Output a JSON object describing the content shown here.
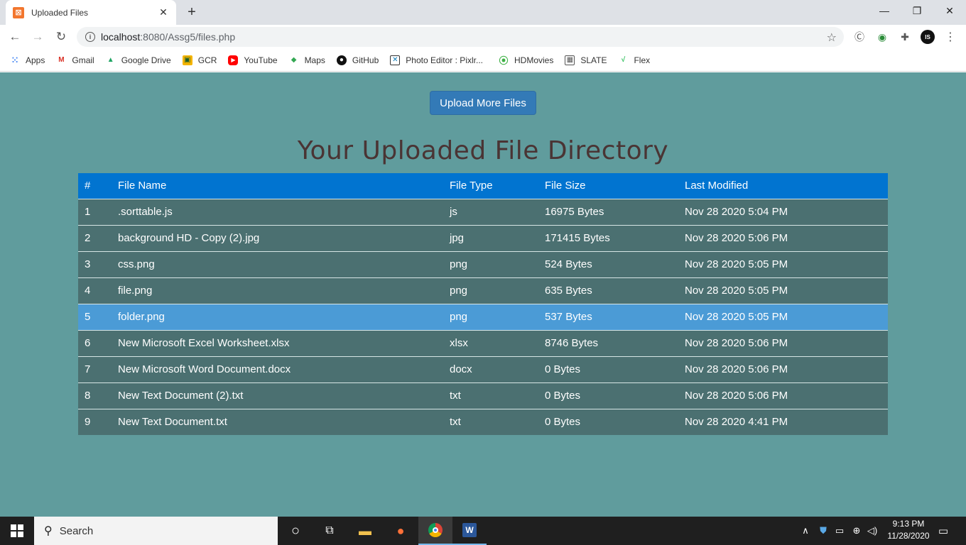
{
  "browser": {
    "tab_title": "Uploaded Files",
    "tab_icon": "xampp-icon",
    "url_host": "localhost",
    "url_rest": ":8080/Assg5/files.php",
    "bookmarks": [
      {
        "label": "Apps",
        "icon": "apps-grid-icon"
      },
      {
        "label": "Gmail",
        "icon": "gmail-icon"
      },
      {
        "label": "Google Drive",
        "icon": "google-drive-icon"
      },
      {
        "label": "GCR",
        "icon": "google-classroom-icon"
      },
      {
        "label": "YouTube",
        "icon": "youtube-icon"
      },
      {
        "label": "Maps",
        "icon": "maps-icon"
      },
      {
        "label": "GitHub",
        "icon": "github-icon"
      },
      {
        "label": "Photo Editor : Pixlr...",
        "icon": "pixlr-icon"
      },
      {
        "label": "HDMovies",
        "icon": "hdmovies-icon"
      },
      {
        "label": "SLATE",
        "icon": "slate-icon"
      },
      {
        "label": "Flex",
        "icon": "flex-icon"
      }
    ]
  },
  "page": {
    "upload_button": "Upload More Files",
    "heading": "Your Uploaded File Directory",
    "table": {
      "headers": [
        "#",
        "File Name",
        "File Type",
        "File Size",
        "Last Modified"
      ],
      "rows": [
        [
          "1",
          ".sorttable.js",
          "js",
          "16975 Bytes",
          "Nov 28 2020 5:04 PM"
        ],
        [
          "2",
          "background HD - Copy (2).jpg",
          "jpg",
          "171415 Bytes",
          "Nov 28 2020 5:06 PM"
        ],
        [
          "3",
          "css.png",
          "png",
          "524 Bytes",
          "Nov 28 2020 5:05 PM"
        ],
        [
          "4",
          "file.png",
          "png",
          "635 Bytes",
          "Nov 28 2020 5:05 PM"
        ],
        [
          "5",
          "folder.png",
          "png",
          "537 Bytes",
          "Nov 28 2020 5:05 PM"
        ],
        [
          "6",
          "New Microsoft Excel Worksheet.xlsx",
          "xlsx",
          "8746 Bytes",
          "Nov 28 2020 5:06 PM"
        ],
        [
          "7",
          "New Microsoft Word Document.docx",
          "docx",
          "0 Bytes",
          "Nov 28 2020 5:06 PM"
        ],
        [
          "8",
          "New Text Document (2).txt",
          "txt",
          "0 Bytes",
          "Nov 28 2020 5:06 PM"
        ],
        [
          "9",
          "New Text Document.txt",
          "txt",
          "0 Bytes",
          "Nov 28 2020 4:41 PM"
        ]
      ],
      "highlighted_row": 5
    }
  },
  "taskbar": {
    "search_label": "Search",
    "time": "9:13 PM",
    "date": "11/28/2020"
  },
  "colors": {
    "page_bg": "#609c9d",
    "header_bg": "#0174d0",
    "row_bg": "#4b7071",
    "highlight_bg": "#4b9bd6",
    "button_bg": "#337ab7",
    "heading_color": "#4a3434"
  }
}
